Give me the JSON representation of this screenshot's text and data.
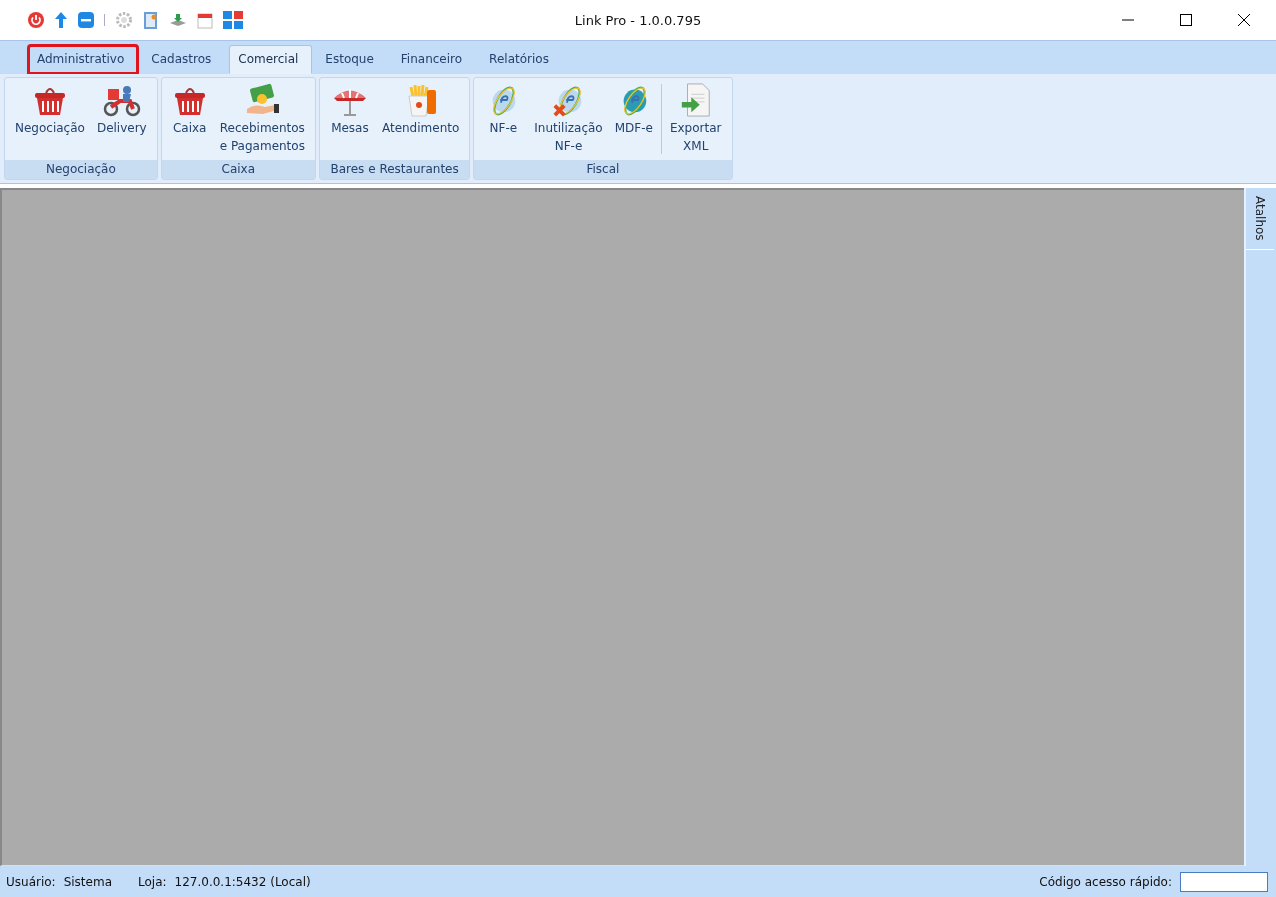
{
  "window": {
    "title": "Link Pro - 1.0.0.795"
  },
  "tabs": [
    {
      "label": "Administrativo",
      "selected": false,
      "highlighted": true
    },
    {
      "label": "Cadastros",
      "selected": false,
      "highlighted": false
    },
    {
      "label": "Comercial",
      "selected": true,
      "highlighted": false
    },
    {
      "label": "Estoque",
      "selected": false,
      "highlighted": false
    },
    {
      "label": "Financeiro",
      "selected": false,
      "highlighted": false
    },
    {
      "label": "Relatórios",
      "selected": false,
      "highlighted": false
    }
  ],
  "ribbon_groups": [
    {
      "caption": "Negociação",
      "buttons": [
        {
          "lines": [
            "Negociação"
          ],
          "separator_before": false
        },
        {
          "lines": [
            "Delivery"
          ],
          "separator_before": false
        }
      ]
    },
    {
      "caption": "Caixa",
      "buttons": [
        {
          "lines": [
            "Caixa"
          ],
          "separator_before": false
        },
        {
          "lines": [
            "Recebimentos",
            "e Pagamentos"
          ],
          "separator_before": false
        }
      ]
    },
    {
      "caption": "Bares e Restaurantes",
      "buttons": [
        {
          "lines": [
            "Mesas"
          ],
          "separator_before": false
        },
        {
          "lines": [
            "Atendimento"
          ],
          "separator_before": false
        }
      ]
    },
    {
      "caption": "Fiscal",
      "buttons": [
        {
          "lines": [
            "NF-e"
          ],
          "separator_before": false
        },
        {
          "lines": [
            "Inutilização",
            "NF-e"
          ],
          "separator_before": false
        },
        {
          "lines": [
            "MDF-e"
          ],
          "separator_before": false
        },
        {
          "lines": [
            "Exportar",
            "XML"
          ],
          "separator_before": true
        }
      ]
    }
  ],
  "side_tab": {
    "label": "Atalhos"
  },
  "status_bar": {
    "user_label": "Usuário:",
    "user": "Sistema",
    "store_label": "Loja:",
    "store": "127.0.0.1:5432 (Local)",
    "quick_label": "Código acesso rápido:"
  }
}
